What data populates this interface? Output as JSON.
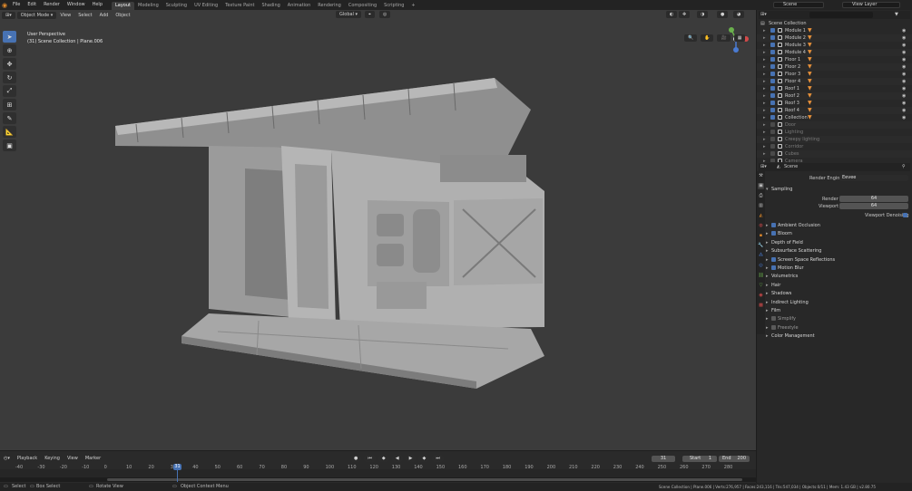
{
  "menu": {
    "items": [
      "File",
      "Edit",
      "Render",
      "Window",
      "Help"
    ],
    "workspaces": [
      "Layout",
      "Modeling",
      "Sculpting",
      "UV Editing",
      "Texture Paint",
      "Shading",
      "Animation",
      "Rendering",
      "Compositing",
      "Scripting"
    ],
    "active_workspace": "Layout",
    "add_tab": "+",
    "scene_field": "Scene",
    "view_layer_field": "View Layer"
  },
  "viewport": {
    "mode": "Object Mode",
    "menus": [
      "View",
      "Select",
      "Add",
      "Object"
    ],
    "transform_orientation": "Global",
    "info_line1": "User Perspective",
    "info_line2": "(31) Scene Collection | Plane.006",
    "bg_color": "#3b3b3b"
  },
  "outliner": {
    "root": "Scene Collection",
    "items": [
      {
        "name": "Module 1",
        "enabled": true
      },
      {
        "name": "Module 2",
        "enabled": true
      },
      {
        "name": "Module 3",
        "enabled": true
      },
      {
        "name": "Module 4",
        "enabled": true
      },
      {
        "name": "Floor 1",
        "enabled": true
      },
      {
        "name": "Floor 2",
        "enabled": true
      },
      {
        "name": "Floor 3",
        "enabled": true
      },
      {
        "name": "Floor 4",
        "enabled": true
      },
      {
        "name": "Roof 1",
        "enabled": true
      },
      {
        "name": "Roof 2",
        "enabled": true
      },
      {
        "name": "Roof 3",
        "enabled": true
      },
      {
        "name": "Roof 4",
        "enabled": true
      },
      {
        "name": "Collection",
        "enabled": true
      },
      {
        "name": "Door",
        "enabled": false
      },
      {
        "name": "Lighting",
        "enabled": false
      },
      {
        "name": "Creepy lighting",
        "enabled": false
      },
      {
        "name": "Corridor",
        "enabled": false
      },
      {
        "name": "Cubes",
        "enabled": false
      },
      {
        "name": "Camera",
        "enabled": false
      }
    ]
  },
  "properties": {
    "scene_name": "Scene",
    "render_engine_label": "Render Engine",
    "render_engine_value": "Eevee",
    "sampling": "Sampling",
    "render_label": "Render",
    "render_value": "64",
    "viewport_label": "Viewport",
    "viewport_value": "64",
    "denoising_label": "Viewport Denoising",
    "panels": [
      {
        "label": "Ambient Occlusion",
        "checkbox": true
      },
      {
        "label": "Bloom",
        "checkbox": true
      },
      {
        "label": "Depth of Field",
        "checkbox": false
      },
      {
        "label": "Subsurface Scattering",
        "checkbox": false
      },
      {
        "label": "Screen Space Reflections",
        "checkbox": true
      },
      {
        "label": "Motion Blur",
        "checkbox": true
      },
      {
        "label": "Volumetrics",
        "checkbox": false
      },
      {
        "label": "Hair",
        "checkbox": false
      },
      {
        "label": "Shadows",
        "checkbox": false
      },
      {
        "label": "Indirect Lighting",
        "checkbox": false
      },
      {
        "label": "Film",
        "checkbox": false
      },
      {
        "label": "Simplify",
        "checkbox": true,
        "dim": true
      },
      {
        "label": "Freestyle",
        "checkbox": true,
        "dim": true
      },
      {
        "label": "Color Management",
        "checkbox": false
      }
    ]
  },
  "timeline": {
    "menus": [
      "Playback",
      "Keying",
      "View",
      "Marker"
    ],
    "current_frame": "31",
    "start_label": "Start",
    "start_value": "1",
    "end_label": "End",
    "end_value": "200",
    "ticks": [
      "-40",
      "-30",
      "-20",
      "-10",
      "0",
      "10",
      "20",
      "30",
      "40",
      "50",
      "60",
      "70",
      "80",
      "90",
      "100",
      "110",
      "120",
      "130",
      "140",
      "150",
      "160",
      "170",
      "180",
      "190",
      "200",
      "210",
      "220",
      "230",
      "240",
      "250",
      "260",
      "270",
      "280"
    ],
    "playhead": "31"
  },
  "status": {
    "select": "Select",
    "box_select": "Box Select",
    "rotate_view": "Rotate View",
    "context_menu": "Object Context Menu",
    "stats": "Scene Collection | Plane.006 | Verts:276,957 | Faces:243,116 | Tris:547,034 | Objects:0/11 | Mem: 1.43 GB | v2.80.75"
  },
  "colors": {
    "accent": "#4772b3",
    "orange": "#e8913a",
    "playhead": "#4772b3"
  }
}
